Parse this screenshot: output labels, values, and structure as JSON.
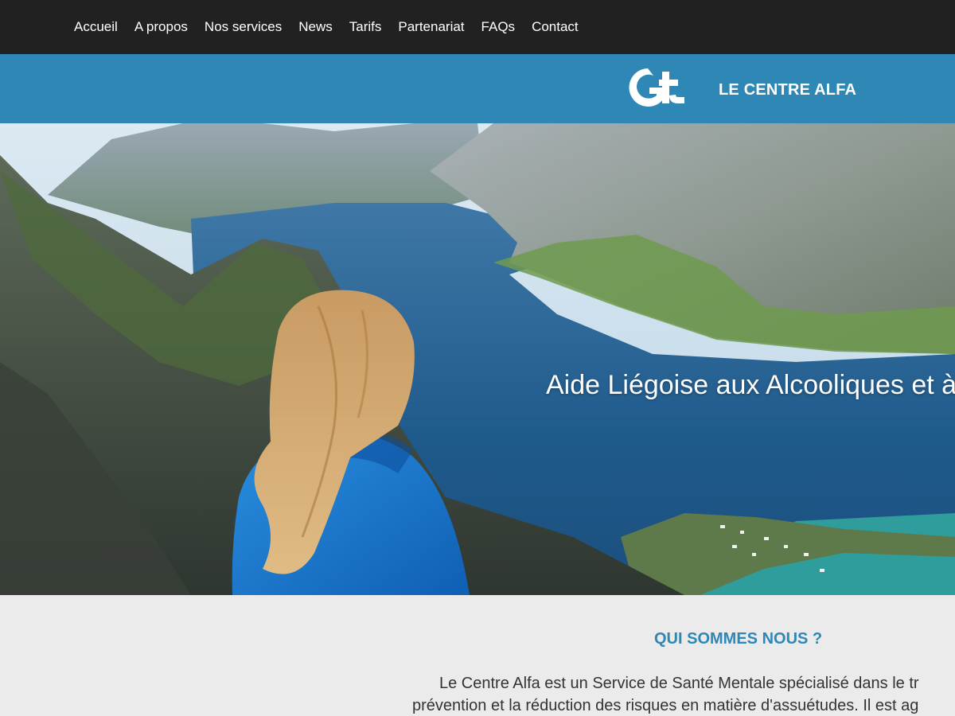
{
  "nav": {
    "items": [
      {
        "label": "Accueil"
      },
      {
        "label": "A propos"
      },
      {
        "label": "Nos services"
      },
      {
        "label": "News"
      },
      {
        "label": "Tarifs"
      },
      {
        "label": "Partenariat"
      },
      {
        "label": "FAQs"
      },
      {
        "label": "Contact"
      }
    ]
  },
  "brand": {
    "name": "LE CENTRE ALFA",
    "logo_icon": "alfa-logo-icon",
    "bar_color": "#2f87b6"
  },
  "hero": {
    "title": "Aide Liégoise aux Alcooliques et à"
  },
  "about": {
    "title": "QUI SOMMES NOUS ?",
    "line1": "Le Centre Alfa est un Service de Santé Mentale spécialisé dans le tr",
    "line2": "prévention et la réduction des risques en matière d'assuétudes. Il est ag"
  },
  "colors": {
    "nav_bg": "#212121",
    "accent": "#2f87b6",
    "section_bg": "#ebebeb",
    "text": "#333333"
  }
}
